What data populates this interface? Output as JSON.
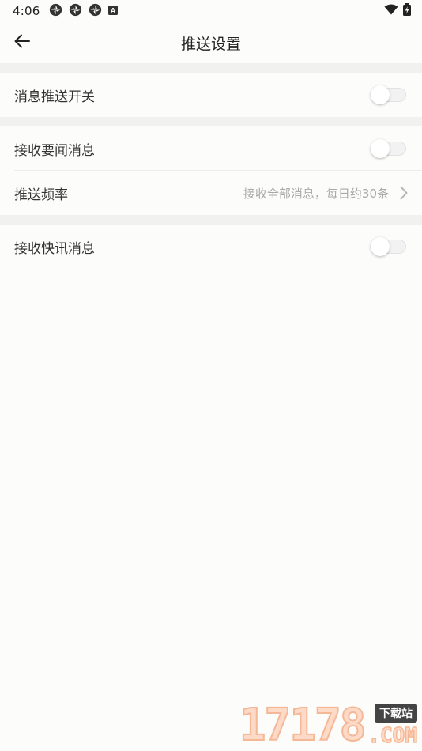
{
  "status_bar": {
    "time": "4:06",
    "icons": [
      "app-notification-icon",
      "app-notification-icon",
      "app-notification-icon",
      "a-badge-icon"
    ],
    "badge_letter": "A"
  },
  "app_bar": {
    "title": "推送设置",
    "back_icon": "arrow-left-icon"
  },
  "settings": {
    "push_switch": {
      "label": "消息推送开关",
      "on": false
    },
    "headline_news": {
      "label": "接收要闻消息",
      "on": false
    },
    "push_frequency": {
      "label": "推送频率",
      "value": "接收全部消息，每日约30条"
    },
    "flash_news": {
      "label": "接收快讯消息",
      "on": false
    }
  },
  "watermark": {
    "number": "17178",
    "tag": "下载站",
    "suffix": ".COM"
  },
  "colors": {
    "background": "#fcfcfa",
    "divider": "#f1f1ef",
    "secondary_text": "#a9a9a9"
  }
}
